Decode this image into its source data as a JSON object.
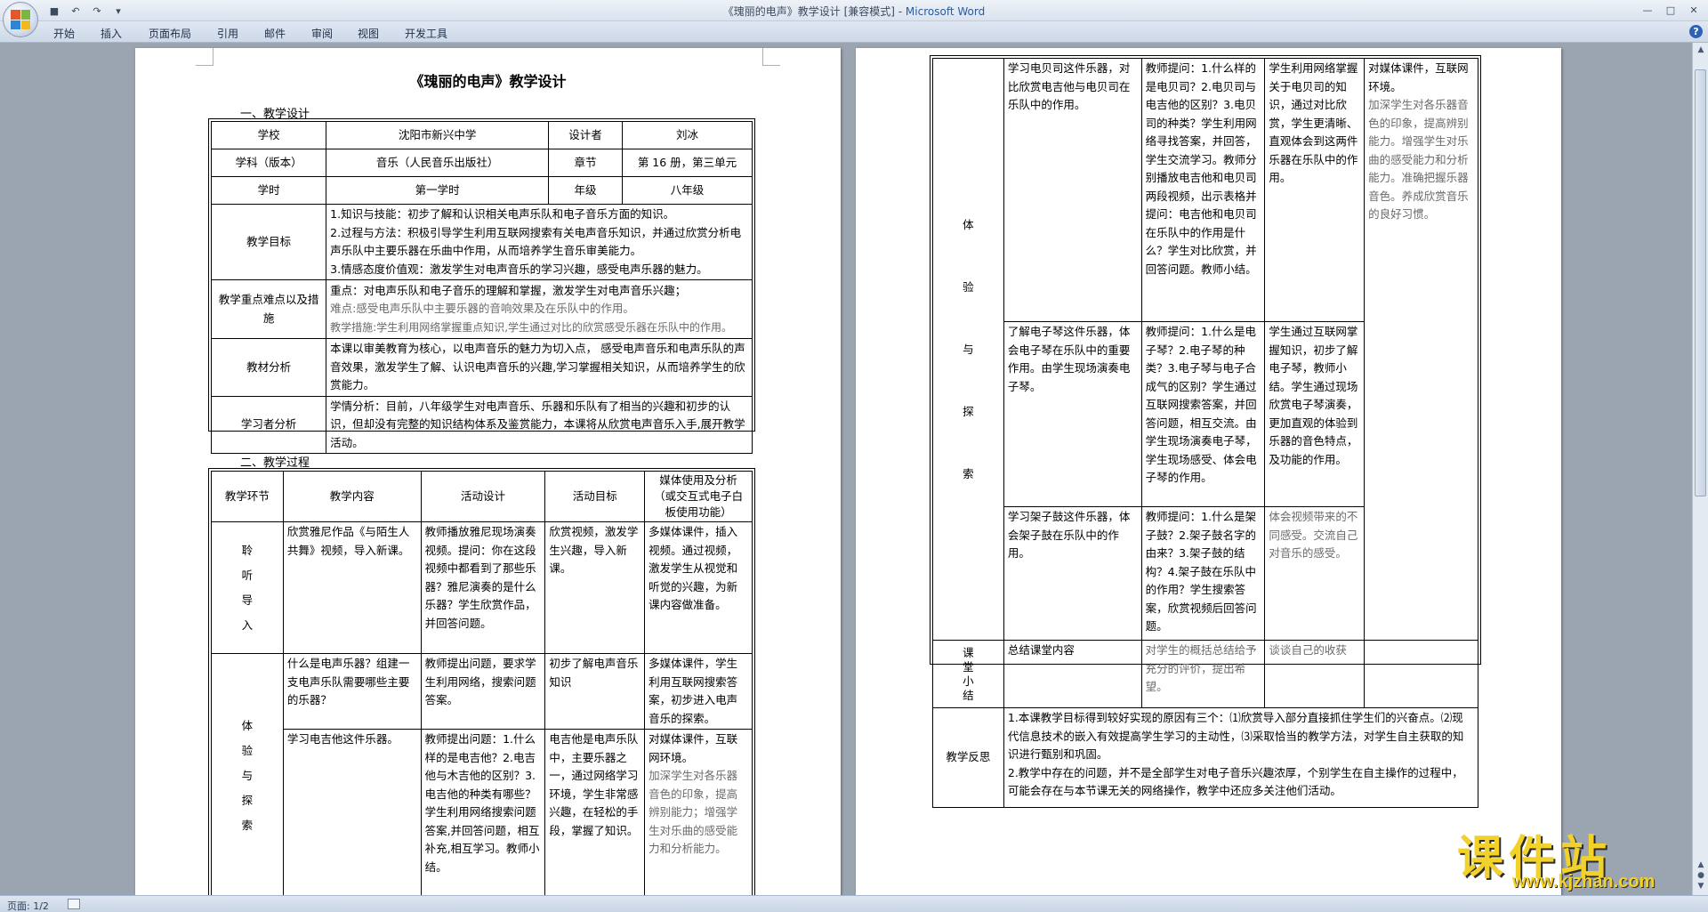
{
  "window": {
    "title_doc": "《瑰丽的电声》教学设计 [兼容模式] - ",
    "title_app": "Microsoft Word"
  },
  "ribbon": {
    "tabs": [
      "开始",
      "插入",
      "页面布局",
      "引用",
      "邮件",
      "审阅",
      "视图",
      "开发工具"
    ]
  },
  "status": {
    "page": "页面: 1/2"
  },
  "doc": {
    "title": "《瑰丽的电声》教学设计",
    "section1": "一、教学设计",
    "section2": "二、教学过程",
    "info": {
      "school_label": "学校",
      "school": "沈阳市新兴中学",
      "designer_label": "设计者",
      "designer": "刘冰",
      "subject_label": "学科（版本）",
      "subject": "音乐（人民音乐出版社）",
      "chapter_label": "章节",
      "chapter": "第 16 册，第三单元",
      "hour_label": "学时",
      "hour": "第一学时",
      "grade_label": "年级",
      "grade": "八年级",
      "goals_label": "教学目标",
      "goals": [
        "1.知识与技能：初步了解和认识相关电声乐队和电子音乐方面的知识。",
        "2.过程与方法：积极引导学生利用互联网搜索有关电声音乐知识，并通过欣赏分析电声乐队中主要乐器在乐曲中作用，从而培养学生音乐审美能力。",
        "3.情感态度价值观：激发学生对电声音乐的学习兴趣，感受电声乐器的魅力。"
      ],
      "key_label": "教学重点难点以及措施",
      "key": [
        "重点：对电声乐队和电子音乐的理解和掌握，激发学生对电声音乐兴趣；",
        "难点:感受电声乐队中主要乐器的音响效果及在乐队中的作用。",
        "教学措施:学生利用网络掌握重点知识,学生通过对比的欣赏感受乐器在乐队中的作用。"
      ],
      "material_label": "教材分析",
      "material": "本课以审美教育为核心，以电声音乐的魅力为切入点， 感受电声音乐和电声乐队的声音效果，激发学生了解、认识电声音乐的兴趣,学习掌握相关知识，从而培养学生的欣赏能力。",
      "learner_label": "学习者分析",
      "learner": "学情分析：目前，八年级学生对电声音乐、乐器和乐队有了相当的兴趣和初步的认识，但却没有完整的知识结构体系及鉴赏能力，本课将从欣赏电声音乐入手,展开教学活动。"
    },
    "process": {
      "headers": [
        "教学环节",
        "教学内容",
        "活动设计",
        "活动目标",
        "媒体使用及分析（或交互式电子白板使用功能）"
      ],
      "stage1": [
        "聆",
        "听",
        "导",
        "入"
      ],
      "stage2": [
        "体",
        "验",
        "与",
        "探",
        "索"
      ],
      "row1": {
        "content": "欣赏雅尼作品《与陌生人共舞》视频，导入新课。",
        "activity": "教师播放雅尼现场演奏视频。提问：你在这段视频中都看到了那些乐器？雅尼演奏的是什么乐器？学生欣赏作品，并回答问题。",
        "goal": "欣赏视频，激发学生兴趣，导入新课。",
        "media": "多媒体课件，插入视频。通过视频，激发学生从视觉和听觉的兴趣，为新课内容做准备。"
      },
      "row2": {
        "content": "什么是电声乐器？组建一支电声乐队需要哪些主要的乐器？",
        "activity": "教师提出问题，要求学生利用网络，搜索问题答案。",
        "goal": "初步了解电声音乐知识",
        "media": "多媒体课件，学生利用互联网搜索答案，初步进入电声音乐的探索。"
      },
      "row3": {
        "content": "学习电吉他这件乐器。",
        "activity": "教师提出问题：1.什么样的是电吉他？2.电吉他与木吉他的区别？3.电吉他的种类有哪些？学生利用网络搜索问题答案,并回答问题，相互补充,相互学习。教师小结。",
        "goal": "电吉他是电声乐队中，主要乐器之一，通过网络学习环境，学生非常感兴趣，在轻松的手段，掌握了知识。",
        "media_black": "对媒体课件，互联网环境。",
        "media_grey": "加深学生对各乐器音色的印象，提高辨别能力；增强学生对乐曲的感受能力和分析能力。"
      }
    },
    "page2": {
      "stage": [
        "体",
        "验",
        "与",
        "探",
        "索"
      ],
      "stage_summary": "课堂小结",
      "rows": [
        {
          "content": "学习电贝司这件乐器，对比欣赏电吉他与电贝司在乐队中的作用。",
          "activity": "教师提问：1.什么样的是电贝司？2.电贝司与电吉他的区别？3.电贝司的种类？学生利用网络寻找答案，并回答，学生交流学习。教师分别播放电吉他和电贝司两段视频，出示表格并提问：电吉他和电贝司在乐队中的作用是什么？学生对比欣赏，并回答问题。教师小结。",
          "goal": "学生利用网络掌握关于电贝司的知识，通过对比欣赏，学生更清晰、直观体会到这两件乐器在乐队中的作用。",
          "media_black": "对媒体课件，互联网环境。",
          "media_grey": "加深学生对各乐器音色的印象，提高辨别能力。增强学生对乐曲的感受能力和分析能力。准确把握乐器音色。养成欣赏音乐的良好习惯。"
        },
        {
          "content": "了解电子琴这件乐器，体会电子琴在乐队中的重要作用。由学生现场演奏电子琴。",
          "activity": "教师提问：1.什么是电子琴？2.电子琴的种类？3.电子琴与电子合成气的区别？学生通过互联网搜索答案，并回答问题，相互交流。由学生现场演奏电子琴，学生现场感受、体会电子琴的作用。",
          "goal": "学生通过互联网掌握知识，初步了解电子琴，教师小结。学生通过现场欣赏电子琴演奏，更加直观的体验到乐器的音色特点，及功能的作用。"
        },
        {
          "content": "学习架子鼓这件乐器，体会架子鼓在乐队中的作用。",
          "activity": "教师提问：1.什么是架子鼓？2.架子鼓名字的由来？3.架子鼓的结构？4.架子鼓在乐队中的作用？学生搜索答案，欣赏视频后回答问题。",
          "goal_grey": "体会视频带来的不同感受。交流自己对音乐的感受。"
        },
        {
          "content": "总结课堂内容",
          "activity_grey": "对学生的概括总结给予充分的评价，提出希望。",
          "goal_grey": "谈谈自己的收获"
        }
      ],
      "reflection_label": "教学反思",
      "reflection": [
        "1.本课教学目标得到较好实现的原因有三个：⑴欣赏导入部分直接抓住学生们的兴奋点。⑵现代信息技术的嵌入有效提高学生学习的主动性，⑶采取恰当的教学方法，对学生自主获取的知识进行甄别和巩固。",
        "2.教学中存在的问题，并不是全部学生对电子音乐兴趣浓厚，个别学生在自主操作的过程中，可能会存在与本节课无关的网络操作，教学中还应多关注他们活动。"
      ]
    }
  },
  "watermark": {
    "cn": "课件站",
    "url": "www.kjzhan.com"
  },
  "colors": {
    "accent": "#2a5aa0",
    "logo": "#f2d22a",
    "grey_text": "#6a6a6a"
  }
}
